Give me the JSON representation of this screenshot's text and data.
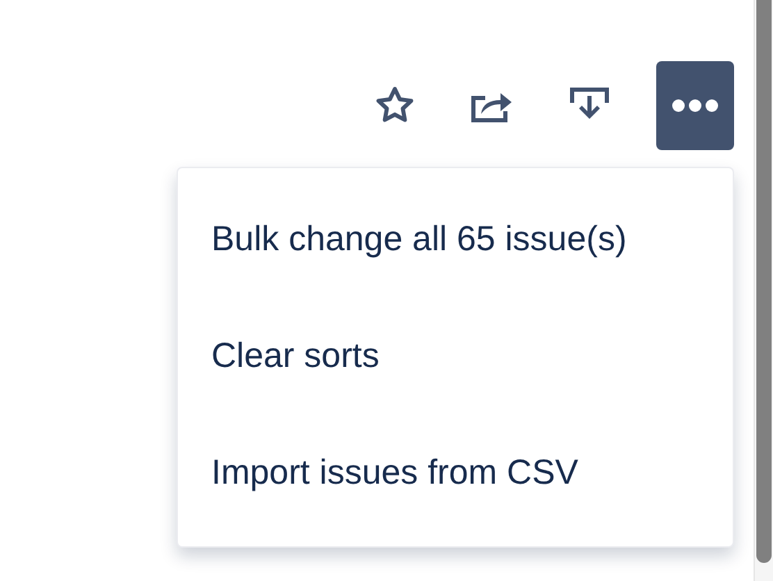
{
  "toolbar": {
    "more_button": {
      "active": true
    }
  },
  "menu": {
    "items": [
      {
        "label": "Bulk change all 65 issue(s)"
      },
      {
        "label": "Clear sorts"
      },
      {
        "label": "Import issues from CSV"
      }
    ]
  }
}
